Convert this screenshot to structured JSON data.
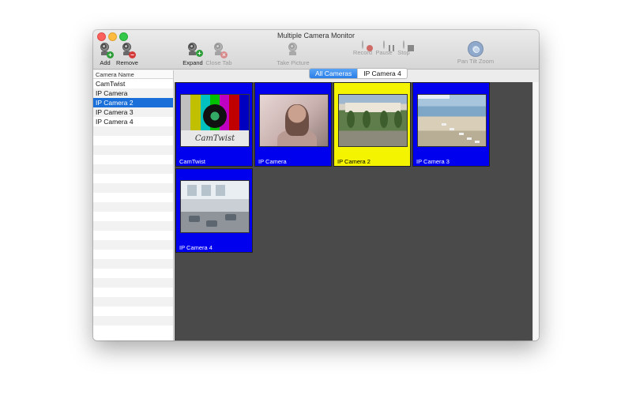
{
  "window": {
    "title": "Multiple Camera Monitor"
  },
  "toolbar": {
    "add": "Add",
    "remove": "Remove",
    "expand": "Expand",
    "close_tab": "Close Tab",
    "take_picture": "Take Picture",
    "record": "Record",
    "pause": "Pause",
    "stop": "Stop",
    "ptz": "Pan Tilt Zoom"
  },
  "sidebar": {
    "header": "Camera Name",
    "items": [
      {
        "label": "CamTwist"
      },
      {
        "label": "IP Camera"
      },
      {
        "label": "IP Camera 2",
        "selected": true
      },
      {
        "label": "IP Camera 3"
      },
      {
        "label": "IP Camera 4"
      }
    ]
  },
  "tabs": [
    {
      "label": "All Cameras",
      "active": true
    },
    {
      "label": "IP Camera 4",
      "active": false
    }
  ],
  "tiles": [
    {
      "caption": "CamTwist",
      "logo_text": "CamTwist"
    },
    {
      "caption": "IP Camera"
    },
    {
      "caption": "IP Camera 2",
      "selected": true
    },
    {
      "caption": "IP Camera 3"
    },
    {
      "caption": "IP Camera 4"
    }
  ],
  "colors": {
    "tile_bg": "#0000ee",
    "tile_selected_bg": "#f4f400",
    "grid_bg": "#4a4a4a",
    "selection_blue": "#1a6fd8"
  }
}
